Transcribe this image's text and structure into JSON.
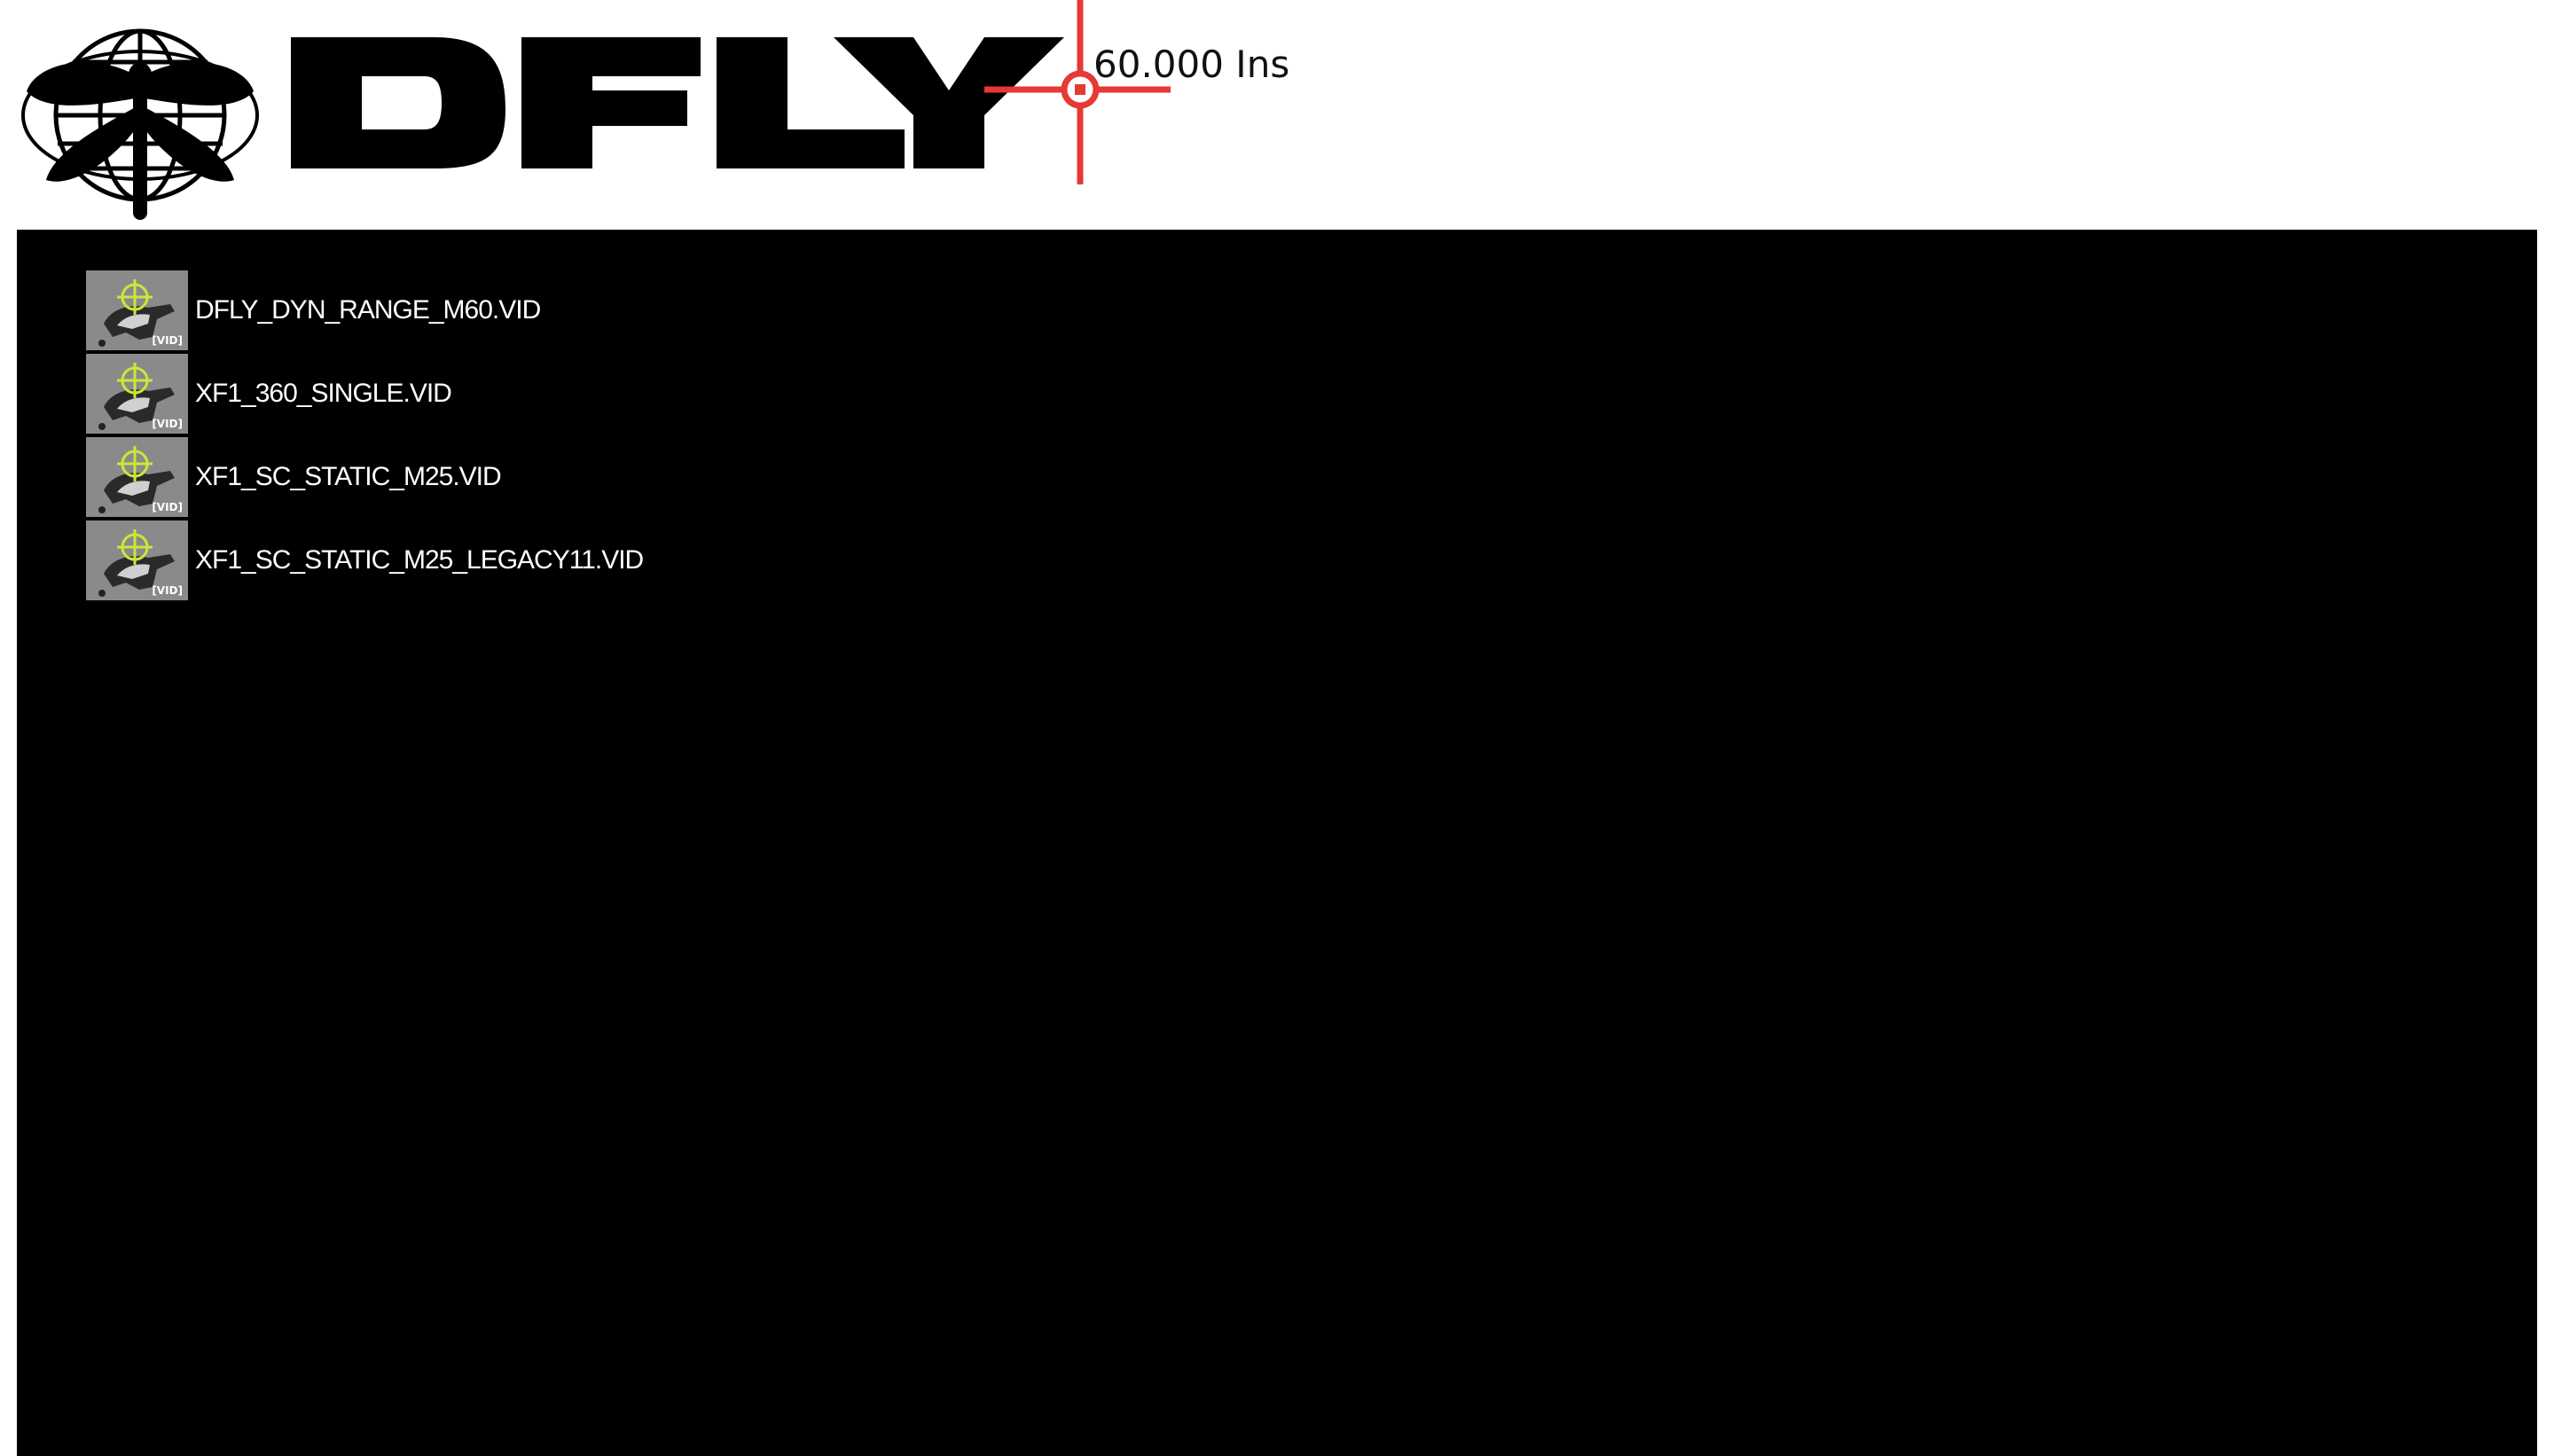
{
  "header": {
    "logo_name": "dragonfly-globe-logo",
    "brand_text_icon": "dfly-wordmark",
    "reticle_icon": "crosshair-reticle-icon",
    "reading": "60.000 Ins",
    "reticle_color": "#e53935"
  },
  "file_list": {
    "items": [
      {
        "name": "DFLY_DYN_RANGE_M60.VID",
        "thumb_tag": "[VID]",
        "icon": "video-file-icon"
      },
      {
        "name": "XF1_360_SINGLE.VID",
        "thumb_tag": "[VID]",
        "icon": "video-file-icon"
      },
      {
        "name": "XF1_SC_STATIC_M25.VID",
        "thumb_tag": "[VID]",
        "icon": "video-file-icon"
      },
      {
        "name": "XF1_SC_STATIC_M25_LEGACY11.VID",
        "thumb_tag": "[VID]",
        "icon": "video-file-icon"
      }
    ]
  },
  "colors": {
    "panel_bg": "#000000",
    "header_bg": "#ffffff",
    "thumb_bg": "#8a8a8a",
    "thumb_target": "#c8e83a"
  }
}
